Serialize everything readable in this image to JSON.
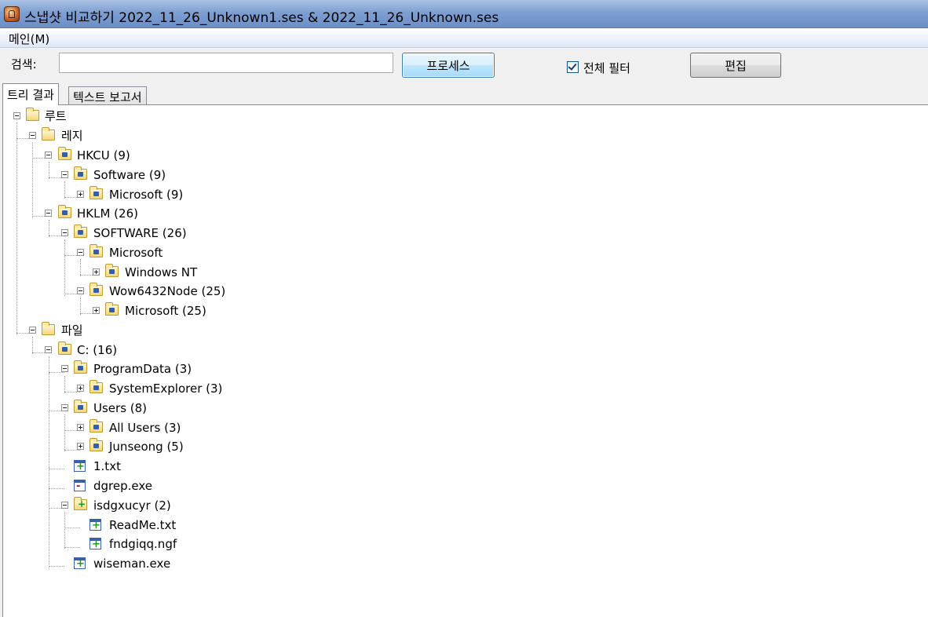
{
  "window": {
    "title": "스냅샷 비교하기 2022_11_26_Unknown1.ses & 2022_11_26_Unknown.ses"
  },
  "menu": {
    "main": "메인(M)"
  },
  "toolbar": {
    "search_label": "검색:",
    "search_value": "",
    "process_button": "프로세스",
    "filter_checkbox_label": "전체 필터",
    "filter_checked": true,
    "edit_button": "편집"
  },
  "tabs": [
    {
      "label": "트리 결과",
      "active": true
    },
    {
      "label": "텍스트 보고서",
      "active": false
    }
  ],
  "tree": {
    "root": "루트",
    "registry": "레지",
    "hkcu": "HKCU (9)",
    "hkcu_software": "Software (9)",
    "hkcu_microsoft": "Microsoft (9)",
    "hklm": "HKLM (26)",
    "hklm_software": "SOFTWARE (26)",
    "hklm_microsoft": "Microsoft",
    "windows_nt": "Windows NT",
    "wow6432node": "Wow6432Node (25)",
    "wow_microsoft": "Microsoft (25)",
    "files": "파일",
    "c_drive": "C: (16)",
    "programdata": "ProgramData (3)",
    "systemexplorer": "SystemExplorer (3)",
    "users": "Users (8)",
    "all_users": "All Users (3)",
    "junseong": "Junseong (5)",
    "file_1txt": "1.txt",
    "file_dgrep": "dgrep.exe",
    "isdgxucyr": "isdgxucyr (2)",
    "file_readme": "ReadMe.txt",
    "file_fndgigq": "fndgiqq.ngf",
    "file_wiseman": "wiseman.exe"
  }
}
